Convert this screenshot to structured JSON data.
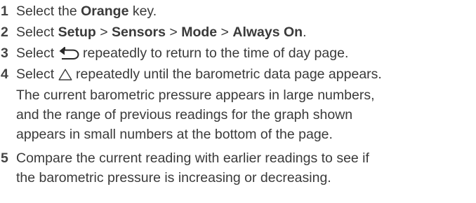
{
  "steps": [
    {
      "number": "1",
      "parts": {
        "t1": "Select the ",
        "b1": "Orange",
        "t2": " key."
      }
    },
    {
      "number": "2",
      "parts": {
        "t1": "Select ",
        "b1": "Setup",
        "sep1": " > ",
        "b2": "Sensors",
        "sep2": " > ",
        "b3": "Mode",
        "sep3": " > ",
        "b4": "Always On",
        "t2": "."
      }
    },
    {
      "number": "3",
      "icon": "back-arrow-icon",
      "parts": {
        "t1": "Select ",
        "t2": " repeatedly to return to the time of day page."
      }
    },
    {
      "number": "4",
      "icon": "up-triangle-icon",
      "parts": {
        "t1": "Select ",
        "t2": " repeatedly until the barometric data page appears."
      },
      "note_lines": [
        "The current barometric pressure appears in large numbers,",
        "and the range of previous readings for the graph shown",
        "appears in small numbers at the bottom of the page."
      ]
    },
    {
      "number": "5",
      "lines": [
        "Compare the current reading with earlier readings to see if",
        "the barometric pressure is increasing or decreasing."
      ]
    }
  ]
}
